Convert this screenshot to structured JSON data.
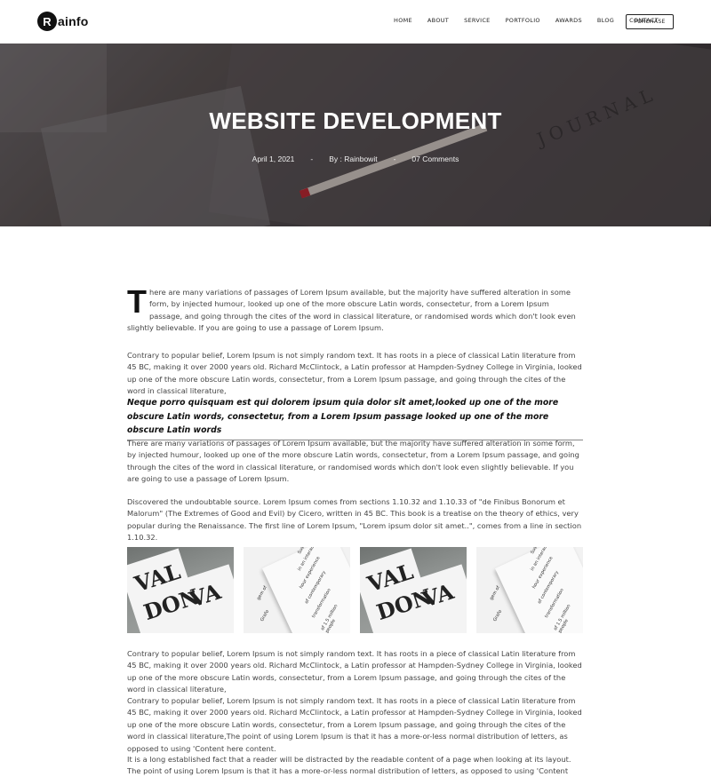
{
  "brand": {
    "logo_letter": "R",
    "logo_rest": "ainfo"
  },
  "nav": {
    "items": [
      "HOME",
      "ABOUT",
      "SERVICE",
      "PORTFOLIO",
      "AWARDS",
      "BLOG",
      "CONTACT"
    ],
    "purchase_label": "PURCHASE"
  },
  "hero": {
    "title": "WEBSITE DEVELOPMENT",
    "date": "April 1, 2021",
    "separator": "-",
    "author": "By : Rainbowit",
    "comments": "07 Comments",
    "image_text": "JOURNAL"
  },
  "article": {
    "dropcap": "T",
    "p1": "here are many variations of passages of Lorem Ipsum available, but the majority have suffered alteration in some form, by injected humour, looked up one of the more obscure Latin words, consectetur, from a Lorem Ipsum passage, and going through the cites of the word in classical literature, or randomised words which don't look even slightly believable. If you are going to use a passage of Lorem Ipsum.",
    "p2": "Contrary to popular belief, Lorem Ipsum is not simply random text. It has roots in a piece of classical Latin literature from 45 BC, making it over 2000 years old. Richard McClintock, a Latin professor at Hampden-Sydney College in Virginia, looked up one of the more obscure Latin words, consectetur, from a Lorem Ipsum passage, and going through the cites of the word in classical literature,",
    "quote": "Neque porro quisquam est qui dolorem ipsum quia dolor sit amet,looked up one of the more obscure Latin words, consectetur, from a Lorem Ipsum passage looked up one of the more obscure Latin words",
    "p3": "There are many variations of passages of Lorem Ipsum available, but the majority have suffered alteration in some form, by injected humour, looked up one of the more obscure Latin words, consectetur, from a Lorem Ipsum passage, and going through the cites of the word in classical literature, or randomised words which don't look even slightly believable. If you are going to use a passage of Lorem Ipsum.",
    "p4": "Discovered the undoubtable source. Lorem Ipsum comes from sections 1.10.32 and 1.10.33 of \"de Finibus Bonorum et Malorum\" (The Extremes of Good and Evil) by Cicero, written in 45 BC. This book is a treatise on the theory of ethics, very popular during the Renaissance. The first line of Lorem Ipsum, \"Lorem ipsum dolor sit amet..\", comes from a line in section 1.10.32.",
    "p5": "Contrary to popular belief, Lorem Ipsum is not simply random text. It has roots in a piece of classical Latin literature from 45 BC, making it over 2000 years old. Richard McClintock, a Latin professor at Hampden-Sydney College in Virginia, looked up one of the more obscure Latin words, consectetur, from a Lorem Ipsum passage, and going through the cites of the word in classical literature,",
    "p6": "Contrary to popular belief, Lorem Ipsum is not simply random text. It has roots in a piece of classical Latin literature from 45 BC, making it over 2000 years old. Richard McClintock, a Latin professor at Hampden-Sydney College in Virginia, looked up one of the more obscure Latin words, consectetur, from a Lorem Ipsum passage, and going through the cites of the word in classical literature,The point of using Lorem Ipsum is that it has a more-or-less normal distribution of letters, as opposed to using 'Content here content.",
    "p7": "It is a long established fact that a reader will be distracted by the readable content of a page when looking at its layout. The point of using Lorem Ipsum is that it has a more-or-less normal distribution of letters, as opposed to using 'Content here, content here alo."
  },
  "gallery": {
    "book_letters": [
      "VAL",
      "DON",
      "VA"
    ],
    "page_text_lines": [
      "Sustain alt design",
      "in an interactive",
      "hour experience",
      "of contemporary",
      "transformation",
      "of 1.5 million people",
      "gem of",
      "Grafo"
    ]
  },
  "colors": {
    "accent": "#111111",
    "hero_overlay": "#3e383a",
    "pencil_tip": "#c0202a"
  }
}
